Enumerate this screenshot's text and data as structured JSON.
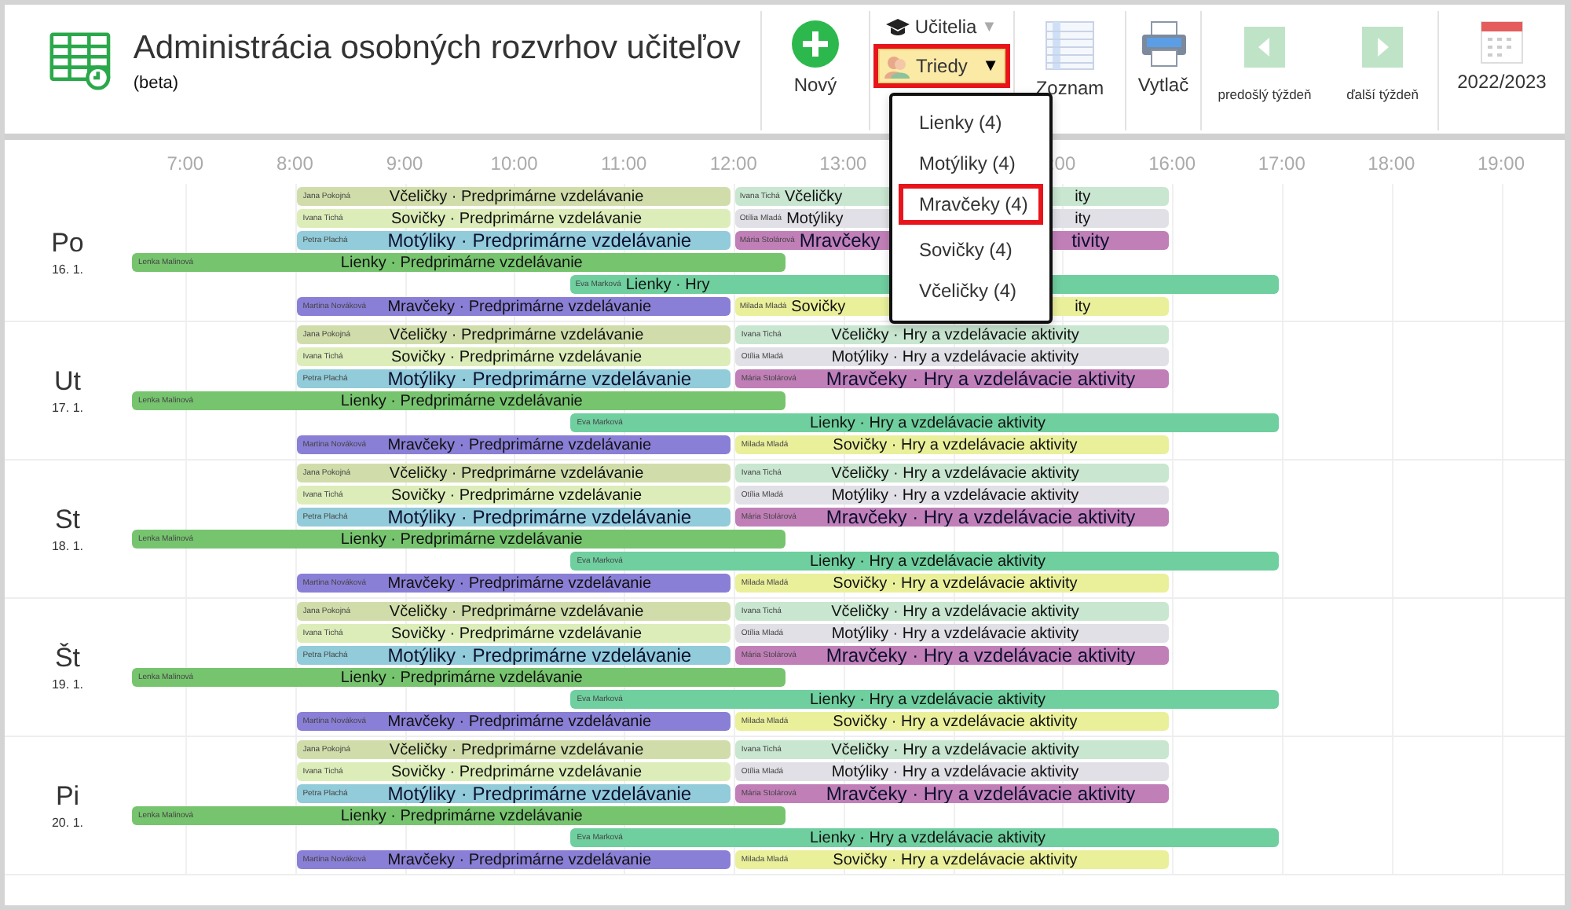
{
  "header": {
    "title": "Administrácia osobných rozvrhov učiteľov",
    "subtitle": "(beta)"
  },
  "toolbar": {
    "new": "Nový",
    "teachers": "Učitelia",
    "teachers_caret": "▼",
    "classes": "Triedy",
    "classes_caret": "▼",
    "classes_open": true,
    "list": "Zoznam",
    "print": "Vytlač",
    "prev_week": "predošlý týždeň",
    "next_week": "ďalší týždeň",
    "year": "2022/2023"
  },
  "class_menu": [
    {
      "label": "Lienky (4)",
      "selected": false
    },
    {
      "label": "Motýliky (4)",
      "selected": false
    },
    {
      "label": "Mravčeky (4)",
      "selected": true
    },
    {
      "label": "Sovičky (4)",
      "selected": false
    },
    {
      "label": "Včeličky (4)",
      "selected": false
    }
  ],
  "hours": [
    "7:00",
    "8:00",
    "9:00",
    "10:00",
    "11:00",
    "12:00",
    "13:00",
    ":00",
    "16:00",
    "17:00",
    "18:00",
    "19:00"
  ],
  "days": [
    {
      "day": "Po",
      "date": "16. 1.",
      "lanes": [
        [
          {
            "kind": "morning",
            "teacher": "Jana Pokojná",
            "title": "Včeličky · Predprimárne vzdelávanie",
            "color": "#d0ddaa",
            "highlighted": false
          },
          {
            "kind": "afternoon",
            "teacher": "Ivana Tichá",
            "title": "Včeličky",
            "title_end": "ity",
            "covered": true,
            "color": "#c9e6d0",
            "highlighted": false
          }
        ],
        [
          {
            "kind": "morning",
            "teacher": "Ivana Tichá",
            "title": "Sovičky · Predprimárne vzdelávanie",
            "color": "#dcedb9",
            "highlighted": false
          },
          {
            "kind": "afternoon",
            "teacher": "Otília Mladá",
            "title": "Motýliky",
            "title_end": "ity",
            "covered": true,
            "color": "#e0e0e6",
            "highlighted": false
          }
        ],
        [
          {
            "kind": "morning",
            "teacher": "Petra Plachá",
            "title": "Motýliky · Predprimárne vzdelávanie",
            "color": "#92cbd9",
            "highlighted": true
          },
          {
            "kind": "afternoon",
            "teacher": "Mária Stolárová",
            "title": "Mravčeky",
            "title_end": "tivity",
            "covered": true,
            "color": "#c17fb8",
            "highlighted": true
          }
        ],
        [
          {
            "kind": "early",
            "teacher": "Lenka Malinová",
            "title": "Lienky · Predprimárne vzdelávanie",
            "color": "#77c46f",
            "highlighted": false
          }
        ],
        [
          {
            "kind": "midday",
            "teacher": "Eva Marková",
            "title": "Lienky · Hry",
            "covered": true,
            "color": "#6fcf9f",
            "highlighted": false
          }
        ],
        [
          {
            "kind": "morning",
            "teacher": "Martina Nováková",
            "title": "Mravčeky · Predprimárne vzdelávanie",
            "color": "#8a7fd6",
            "highlighted": false
          },
          {
            "kind": "afternoon",
            "teacher": "Milada Mladá",
            "title": "Sovičky",
            "title_end": "ity",
            "covered": true,
            "color": "#eaf09a",
            "highlighted": false
          }
        ]
      ]
    },
    {
      "day": "Ut",
      "date": "17. 1.",
      "lanes": [
        [
          {
            "kind": "morning",
            "teacher": "Jana Pokojná",
            "title": "Včeličky · Predprimárne vzdelávanie",
            "color": "#d0ddaa",
            "highlighted": false
          },
          {
            "kind": "afternoon",
            "teacher": "Ivana Tichá",
            "title": "Včeličky · Hry a vzdelávacie aktivity",
            "color": "#c9e6d0",
            "highlighted": false
          }
        ],
        [
          {
            "kind": "morning",
            "teacher": "Ivana Tichá",
            "title": "Sovičky · Predprimárne vzdelávanie",
            "color": "#dcedb9",
            "highlighted": false
          },
          {
            "kind": "afternoon",
            "teacher": "Otília Mladá",
            "title": "Motýliky · Hry a vzdelávacie aktivity",
            "color": "#e0e0e6",
            "highlighted": false
          }
        ],
        [
          {
            "kind": "morning",
            "teacher": "Petra Plachá",
            "title": "Motýliky · Predprimárne vzdelávanie",
            "color": "#92cbd9",
            "highlighted": true
          },
          {
            "kind": "afternoon",
            "teacher": "Mária Stolárová",
            "title": "Mravčeky · Hry a vzdelávacie aktivity",
            "color": "#c17fb8",
            "highlighted": true
          }
        ],
        [
          {
            "kind": "early",
            "teacher": "Lenka Malinová",
            "title": "Lienky · Predprimárne vzdelávanie",
            "color": "#77c46f",
            "highlighted": false
          }
        ],
        [
          {
            "kind": "midday",
            "teacher": "Eva Marková",
            "title": "Lienky · Hry a vzdelávacie aktivity",
            "color": "#6fcf9f",
            "highlighted": false
          }
        ],
        [
          {
            "kind": "morning",
            "teacher": "Martina Nováková",
            "title": "Mravčeky · Predprimárne vzdelávanie",
            "color": "#8a7fd6",
            "highlighted": false
          },
          {
            "kind": "afternoon",
            "teacher": "Milada Mladá",
            "title": "Sovičky · Hry a vzdelávacie aktivity",
            "color": "#eaf09a",
            "highlighted": false
          }
        ]
      ]
    },
    {
      "day": "St",
      "date": "18. 1.",
      "lanes": [
        [
          {
            "kind": "morning",
            "teacher": "Jana Pokojná",
            "title": "Včeličky · Predprimárne vzdelávanie",
            "color": "#d0ddaa",
            "highlighted": false
          },
          {
            "kind": "afternoon",
            "teacher": "Ivana Tichá",
            "title": "Včeličky · Hry a vzdelávacie aktivity",
            "color": "#c9e6d0",
            "highlighted": false
          }
        ],
        [
          {
            "kind": "morning",
            "teacher": "Ivana Tichá",
            "title": "Sovičky · Predprimárne vzdelávanie",
            "color": "#dcedb9",
            "highlighted": false
          },
          {
            "kind": "afternoon",
            "teacher": "Otília Mladá",
            "title": "Motýliky · Hry a vzdelávacie aktivity",
            "color": "#e0e0e6",
            "highlighted": false
          }
        ],
        [
          {
            "kind": "morning",
            "teacher": "Petra Plachá",
            "title": "Motýliky · Predprimárne vzdelávanie",
            "color": "#92cbd9",
            "highlighted": true
          },
          {
            "kind": "afternoon",
            "teacher": "Mária Stolárová",
            "title": "Mravčeky · Hry a vzdelávacie aktivity",
            "color": "#c17fb8",
            "highlighted": true
          }
        ],
        [
          {
            "kind": "early",
            "teacher": "Lenka Malinová",
            "title": "Lienky · Predprimárne vzdelávanie",
            "color": "#77c46f",
            "highlighted": false
          }
        ],
        [
          {
            "kind": "midday",
            "teacher": "Eva Marková",
            "title": "Lienky · Hry a vzdelávacie aktivity",
            "color": "#6fcf9f",
            "highlighted": false
          }
        ],
        [
          {
            "kind": "morning",
            "teacher": "Martina Nováková",
            "title": "Mravčeky · Predprimárne vzdelávanie",
            "color": "#8a7fd6",
            "highlighted": false
          },
          {
            "kind": "afternoon",
            "teacher": "Milada Mladá",
            "title": "Sovičky · Hry a vzdelávacie aktivity",
            "color": "#eaf09a",
            "highlighted": false
          }
        ]
      ]
    },
    {
      "day": "Št",
      "date": "19. 1.",
      "lanes": [
        [
          {
            "kind": "morning",
            "teacher": "Jana Pokojná",
            "title": "Včeličky · Predprimárne vzdelávanie",
            "color": "#d0ddaa",
            "highlighted": false
          },
          {
            "kind": "afternoon",
            "teacher": "Ivana Tichá",
            "title": "Včeličky · Hry a vzdelávacie aktivity",
            "color": "#c9e6d0",
            "highlighted": false
          }
        ],
        [
          {
            "kind": "morning",
            "teacher": "Ivana Tichá",
            "title": "Sovičky · Predprimárne vzdelávanie",
            "color": "#dcedb9",
            "highlighted": false
          },
          {
            "kind": "afternoon",
            "teacher": "Otília Mladá",
            "title": "Motýliky · Hry a vzdelávacie aktivity",
            "color": "#e0e0e6",
            "highlighted": false
          }
        ],
        [
          {
            "kind": "morning",
            "teacher": "Petra Plachá",
            "title": "Motýliky · Predprimárne vzdelávanie",
            "color": "#92cbd9",
            "highlighted": true
          },
          {
            "kind": "afternoon",
            "teacher": "Mária Stolárová",
            "title": "Mravčeky · Hry a vzdelávacie aktivity",
            "color": "#c17fb8",
            "highlighted": true
          }
        ],
        [
          {
            "kind": "early",
            "teacher": "Lenka Malinová",
            "title": "Lienky · Predprimárne vzdelávanie",
            "color": "#77c46f",
            "highlighted": false
          }
        ],
        [
          {
            "kind": "midday",
            "teacher": "Eva Marková",
            "title": "Lienky · Hry a vzdelávacie aktivity",
            "color": "#6fcf9f",
            "highlighted": false
          }
        ],
        [
          {
            "kind": "morning",
            "teacher": "Martina Nováková",
            "title": "Mravčeky · Predprimárne vzdelávanie",
            "color": "#8a7fd6",
            "highlighted": false
          },
          {
            "kind": "afternoon",
            "teacher": "Milada Mladá",
            "title": "Sovičky · Hry a vzdelávacie aktivity",
            "color": "#eaf09a",
            "highlighted": false
          }
        ]
      ]
    },
    {
      "day": "Pi",
      "date": "20. 1.",
      "lanes": [
        [
          {
            "kind": "morning",
            "teacher": "Jana Pokojná",
            "title": "Včeličky · Predprimárne vzdelávanie",
            "color": "#d0ddaa",
            "highlighted": false
          },
          {
            "kind": "afternoon",
            "teacher": "Ivana Tichá",
            "title": "Včeličky · Hry a vzdelávacie aktivity",
            "color": "#c9e6d0",
            "highlighted": false
          }
        ],
        [
          {
            "kind": "morning",
            "teacher": "Ivana Tichá",
            "title": "Sovičky · Predprimárne vzdelávanie",
            "color": "#dcedb9",
            "highlighted": false
          },
          {
            "kind": "afternoon",
            "teacher": "Otília Mladá",
            "title": "Motýliky · Hry a vzdelávacie aktivity",
            "color": "#e0e0e6",
            "highlighted": false
          }
        ],
        [
          {
            "kind": "morning",
            "teacher": "Petra Plachá",
            "title": "Motýliky · Predprimárne vzdelávanie",
            "color": "#92cbd9",
            "highlighted": true
          },
          {
            "kind": "afternoon",
            "teacher": "Mária Stolárová",
            "title": "Mravčeky · Hry a vzdelávacie aktivity",
            "color": "#c17fb8",
            "highlighted": true
          }
        ],
        [
          {
            "kind": "early",
            "teacher": "Lenka Malinová",
            "title": "Lienky · Predprimárne vzdelávanie",
            "color": "#77c46f",
            "highlighted": false
          }
        ],
        [
          {
            "kind": "midday",
            "teacher": "Eva Marková",
            "title": "Lienky · Hry a vzdelávacie aktivity",
            "color": "#6fcf9f",
            "highlighted": false
          }
        ],
        [
          {
            "kind": "morning",
            "teacher": "Martina Nováková",
            "title": "Mravčeky · Predprimárne vzdelávanie",
            "color": "#8a7fd6",
            "highlighted": false
          },
          {
            "kind": "afternoon",
            "teacher": "Milada Mladá",
            "title": "Sovičky · Hry a vzdelávacie aktivity",
            "color": "#eaf09a",
            "highlighted": false
          }
        ]
      ]
    }
  ]
}
